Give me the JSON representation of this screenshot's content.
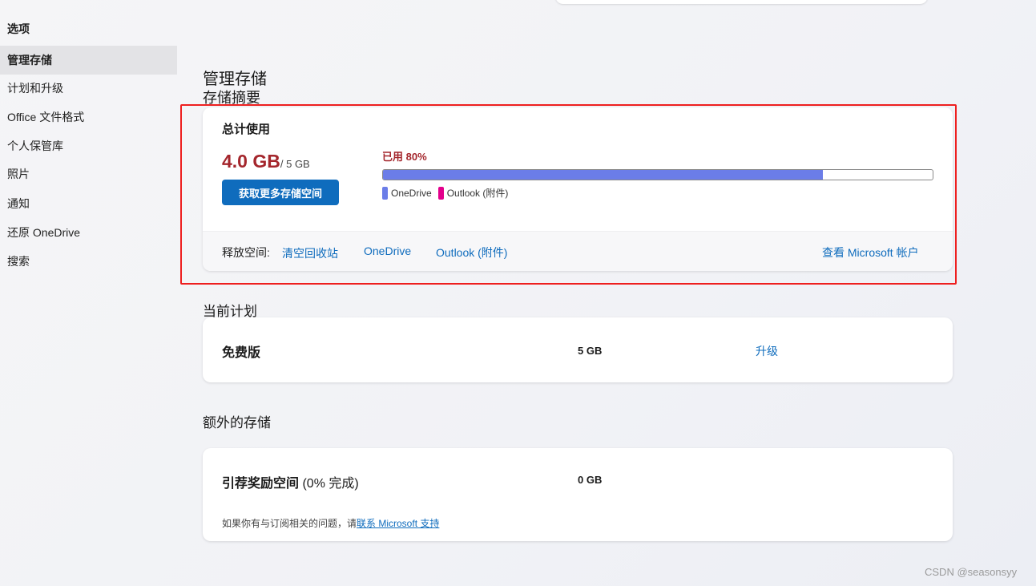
{
  "sidebar": {
    "header": "选项",
    "items": [
      {
        "label": "管理存储",
        "active": true
      },
      {
        "label": "计划和升级"
      },
      {
        "label": "Office 文件格式"
      },
      {
        "label": "个人保管库"
      },
      {
        "label": "照片"
      },
      {
        "label": "通知"
      },
      {
        "label": "还原 OneDrive"
      },
      {
        "label": "搜索"
      }
    ]
  },
  "main": {
    "title": "管理存储",
    "summary": {
      "section_title": "存储摘要",
      "total_label": "总计使用",
      "used": "4.0 GB",
      "capacity": "/ 5 GB",
      "more_storage_button": "获取更多存储空间",
      "used_percent_label": "已用 80%",
      "used_fraction": 0.8,
      "legend": [
        {
          "label": "OneDrive",
          "color": "#6b7de8"
        },
        {
          "label": "Outlook (附件)",
          "color": "#e3008c"
        }
      ],
      "free_up": {
        "label": "释放空间:",
        "links": [
          "清空回收站",
          "OneDrive",
          "Outlook (附件)"
        ],
        "account_link": "查看 Microsoft 帐户"
      }
    },
    "current_plan": {
      "section_title": "当前计划",
      "name": "免费版",
      "size": "5 GB",
      "upgrade_link": "升级"
    },
    "extra_storage": {
      "section_title": "额外的存储",
      "name": "引荐奖励空间",
      "progress": "(0% 完成)",
      "size": "0 GB",
      "footnote": "如果你有与订阅相关的问题，请",
      "footnote_link": "联系 Microsoft 支持"
    }
  },
  "watermark": "CSDN @seasonsyy",
  "colors": {
    "accent": "#0f6cbd",
    "warning_red": "#a4262c",
    "highlight_border": "#ee1f1f"
  }
}
